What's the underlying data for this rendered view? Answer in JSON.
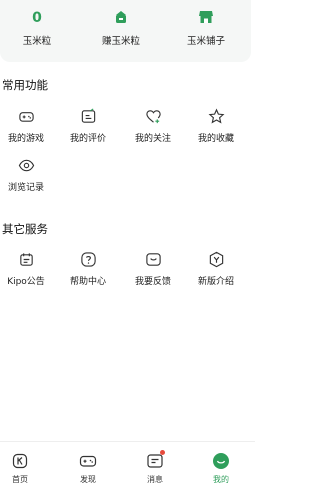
{
  "stats": {
    "corn_count": "0",
    "corn_label": "玉米粒",
    "earn_label": "赚玉米粒",
    "shop_label": "玉米铺子"
  },
  "common": {
    "title": "常用功能",
    "items": [
      {
        "label": "我的游戏",
        "icon": "gamepad-icon"
      },
      {
        "label": "我的评价",
        "icon": "edit-note-icon"
      },
      {
        "label": "我的关注",
        "icon": "heart-plus-icon"
      },
      {
        "label": "我的收藏",
        "icon": "star-icon"
      },
      {
        "label": "浏览记录",
        "icon": "eye-icon"
      }
    ]
  },
  "services": {
    "title": "其它服务",
    "items": [
      {
        "label": "Kipo公告",
        "icon": "announcement-icon"
      },
      {
        "label": "帮助中心",
        "icon": "help-icon"
      },
      {
        "label": "我要反馈",
        "icon": "feedback-icon"
      },
      {
        "label": "新版介绍",
        "icon": "new-version-icon"
      }
    ]
  },
  "nav": {
    "items": [
      {
        "label": "首页",
        "icon": "home-icon"
      },
      {
        "label": "发现",
        "icon": "discover-icon"
      },
      {
        "label": "消息",
        "icon": "message-icon"
      },
      {
        "label": "我的",
        "icon": "profile-icon"
      }
    ],
    "active": "我的"
  },
  "colors": {
    "accent": "#2f9e5b",
    "badge": "#e64a3c",
    "stats_bg": "#f5f7f6"
  }
}
